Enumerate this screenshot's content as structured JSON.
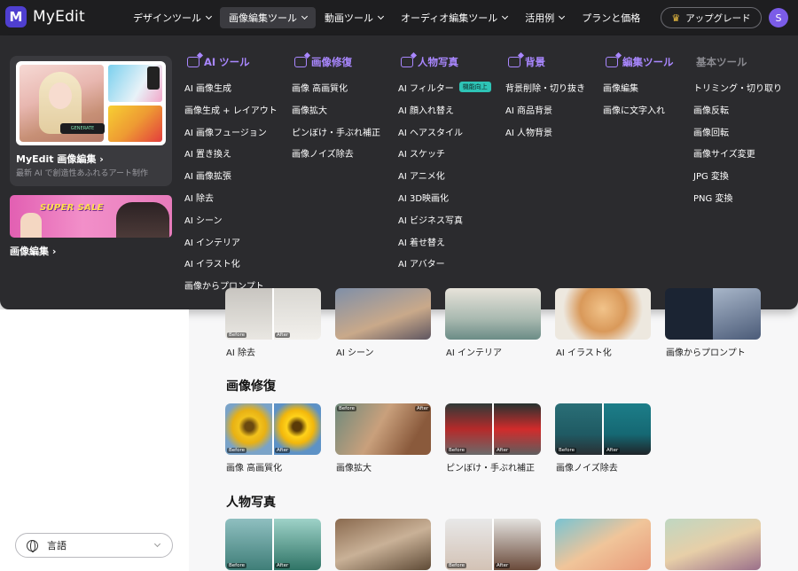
{
  "brand": {
    "name": "MyEdit"
  },
  "nav": {
    "items": [
      {
        "label": "デザインツール"
      },
      {
        "label": "画像編集ツール"
      },
      {
        "label": "動画ツール"
      },
      {
        "label": "オーディオ編集ツール"
      },
      {
        "label": "活用例"
      },
      {
        "label": "プランと価格"
      }
    ],
    "upgrade_label": "アップグレード",
    "avatar_initial": "S"
  },
  "mega_menu": {
    "promo_main": {
      "title": "MyEdit 画像編集 ›",
      "subtitle": "最新 AI で創造性あふれるアート制作",
      "generate_badge": "GENERATE"
    },
    "promo_sale": {
      "text": "SUPER SALE",
      "label": "画像編集 ›"
    },
    "columns": [
      {
        "heading": "AI ツール",
        "items": [
          "AI 画像生成",
          "画像生成 + レイアウト",
          "AI 画像フュージョン",
          "AI 置き換え",
          "AI 画像拡張",
          "AI 除去",
          "AI シーン",
          "AI インテリア",
          "AI イラスト化",
          "画像からプロンプト"
        ]
      },
      {
        "heading": "画像修復",
        "items": [
          "画像 高画質化",
          "画像拡大",
          "ピンぼけ・手ぶれ補正",
          "画像ノイズ除去"
        ]
      },
      {
        "heading": "人物写真",
        "items": [
          "AI フィルター",
          "AI 顔入れ替え",
          "AI ヘアスタイル",
          "AI スケッチ",
          "AI アニメ化",
          "AI 3D映画化",
          "AI ビジネス写真",
          "AI 着せ替え",
          "AI アバター"
        ],
        "badge": "機能向上"
      },
      {
        "heading": "背景",
        "items": [
          "背景削除・切り抜き",
          "AI 商品背景",
          "AI 人物背景"
        ]
      },
      {
        "heading": "編集ツール",
        "items": [
          "画像編集",
          "画像に文字入れ"
        ]
      },
      {
        "heading": "基本ツール",
        "items": [
          "トリミング・切り取り",
          "画像反転",
          "画像回転",
          "画像サイズ変更",
          "JPG 変換",
          "PNG 変換"
        ]
      }
    ]
  },
  "sidebar": {
    "language_label": "言語"
  },
  "content": {
    "row1_captions": [
      "AI 除去",
      "AI シーン",
      "AI インテリア",
      "AI イラスト化",
      "画像からプロンプト"
    ],
    "section_restore": {
      "title": "画像修復",
      "captions": [
        "画像 高画質化",
        "画像拡大",
        "ピンぼけ・手ぶれ補正",
        "画像ノイズ除去"
      ]
    },
    "section_portrait": {
      "title": "人物写真"
    },
    "before_label": "Before",
    "after_label": "After"
  },
  "colors": {
    "accent": "#a987ff",
    "topbar": "#1e1e20",
    "menu": "#2b2b2e",
    "badge": "#2ec4b6"
  }
}
